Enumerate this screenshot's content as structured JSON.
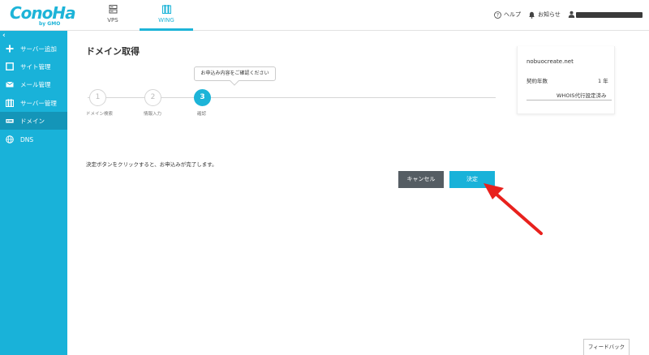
{
  "header": {
    "logo_text": "ConoHa",
    "logo_sub": "by GMO",
    "nav": [
      {
        "label": "VPS",
        "icon": "server-icon"
      },
      {
        "label": "WING",
        "icon": "wing-server-icon"
      }
    ],
    "help_label": "ヘルプ",
    "notice_label": "お知らせ"
  },
  "sidebar": {
    "collapse_glyph": "‹",
    "items": [
      {
        "label": "サーバー追加",
        "icon": "plus-icon"
      },
      {
        "label": "サイト管理",
        "icon": "site-icon"
      },
      {
        "label": "メール管理",
        "icon": "mail-icon"
      },
      {
        "label": "サーバー管理",
        "icon": "server-icon"
      },
      {
        "label": "ドメイン",
        "icon": "domain-icon"
      },
      {
        "label": "DNS",
        "icon": "globe-icon"
      }
    ]
  },
  "main": {
    "title": "ドメイン取得",
    "tooltip": "お申込み内容をご確認ください",
    "steps": [
      {
        "number": "1",
        "label": "ドメイン検索"
      },
      {
        "number": "2",
        "label": "情報入力"
      },
      {
        "number": "3",
        "label": "確認"
      }
    ],
    "note": "決定ボタンをクリックすると、お申込みが完了します。",
    "cancel_label": "キャンセル",
    "decide_label": "決定"
  },
  "summary": {
    "domain": "nobuocreate.net",
    "contract_label": "契約年数",
    "contract_value": "1 年",
    "whois": "WHOIS代行設定済み"
  },
  "feedback_label": "フィードバック",
  "colors": {
    "accent": "#19b2d9",
    "sidebar_active": "#1495b8",
    "cancel": "#555d63",
    "annotation_arrow": "#e8211d"
  }
}
